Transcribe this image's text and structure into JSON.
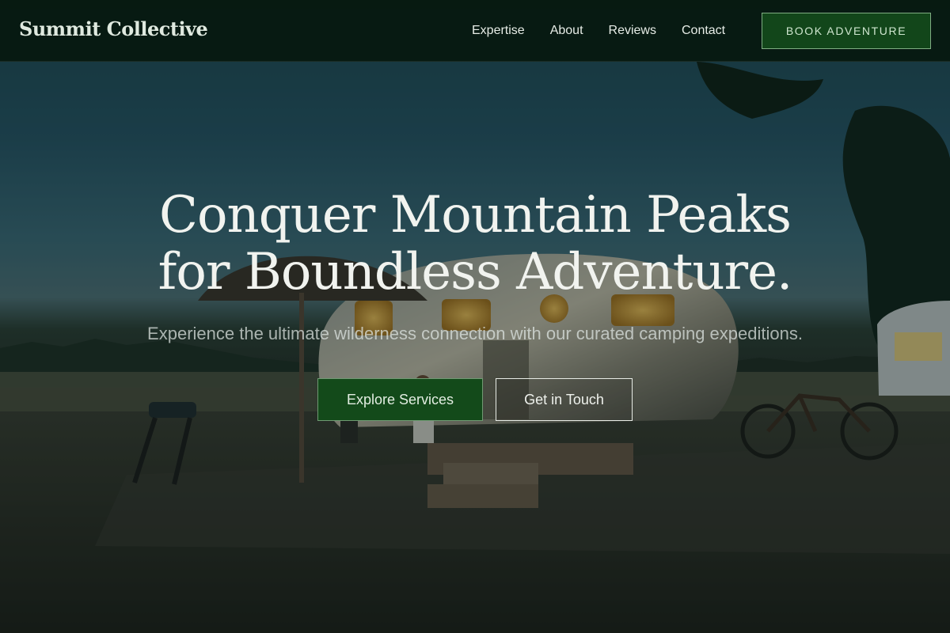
{
  "navbar": {
    "brand": "Summit Collective",
    "links": [
      {
        "label": "Expertise"
      },
      {
        "label": "About"
      },
      {
        "label": "Reviews"
      },
      {
        "label": "Contact"
      }
    ],
    "cta_label": "BOOK ADVENTURE"
  },
  "hero": {
    "title_line1": "Conquer Mountain Peaks",
    "title_line2": "for Boundless Adventure.",
    "subtitle": "Experience the ultimate wilderness connection with our curated camping expeditions.",
    "primary_button": "Explore Services",
    "secondary_button": "Get in Touch",
    "background_image": "camper-trailer-at-dusk-photo"
  },
  "colors": {
    "nav_background": "#06180e",
    "brand_green": "#134a1a",
    "text_light": "#f1f3ef"
  }
}
